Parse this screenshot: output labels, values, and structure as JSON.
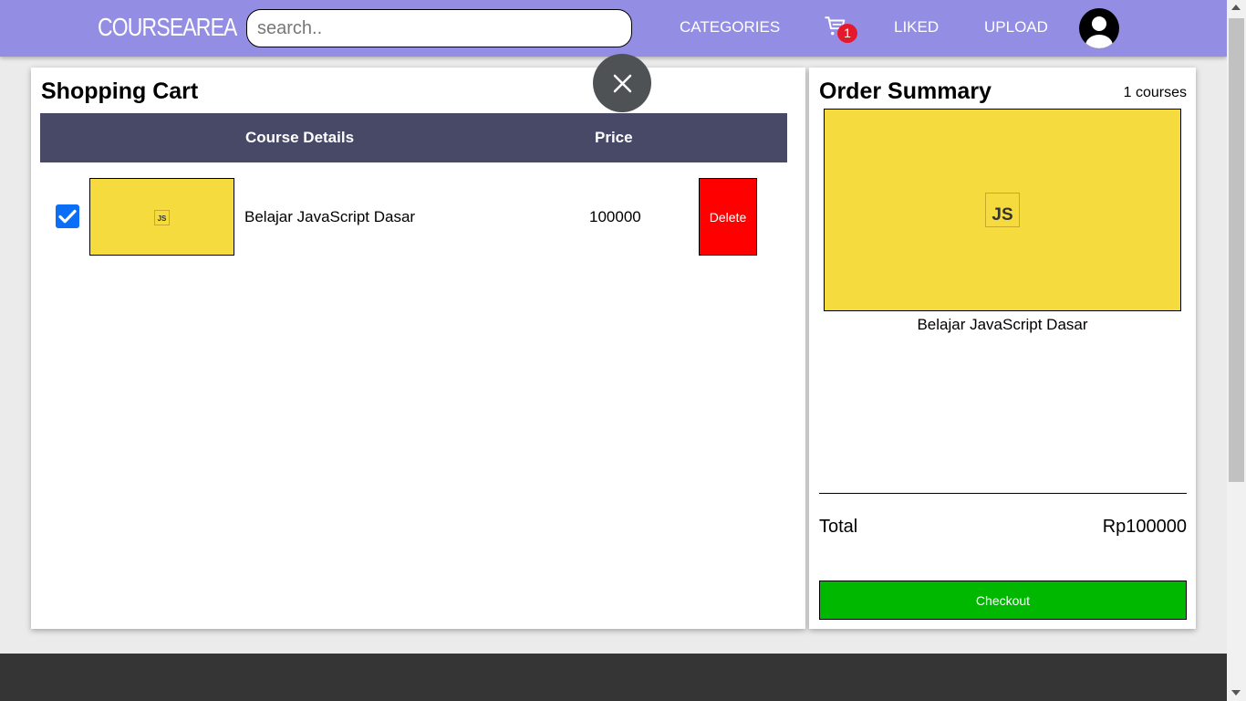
{
  "navbar": {
    "logo": "COURSEAREA",
    "search_placeholder": "search..",
    "links": {
      "categories": "CATEGORIES",
      "liked": "LIKED",
      "upload": "UPLOAD"
    },
    "cart_count": "1",
    "icons": {
      "cart": "cart-icon",
      "avatar": "user-avatar-icon"
    },
    "colors": {
      "background": "#938ee4",
      "badge": "#e4192b"
    }
  },
  "close_button": {
    "icon": "close-icon"
  },
  "cart": {
    "title": "Shopping Cart",
    "headers": {
      "details": "Course Details",
      "price": "Price"
    },
    "items": [
      {
        "checked": true,
        "thumbnail_text": "JS",
        "title": "Belajar JavaScript Dasar",
        "price": "100000",
        "delete_label": "Delete"
      }
    ],
    "colors": {
      "header": "#474966",
      "delete": "#ff0000",
      "checkbox": "#0b6ef7",
      "thumbnail": "#f6db3e"
    }
  },
  "summary": {
    "title": "Order Summary",
    "count": "1 courses",
    "thumbnail_text": "JS",
    "course_title": "Belajar JavaScript Dasar",
    "total_label": "Total",
    "total_value": "Rp100000",
    "checkout_label": "Checkout",
    "colors": {
      "checkout": "#00b800"
    }
  }
}
